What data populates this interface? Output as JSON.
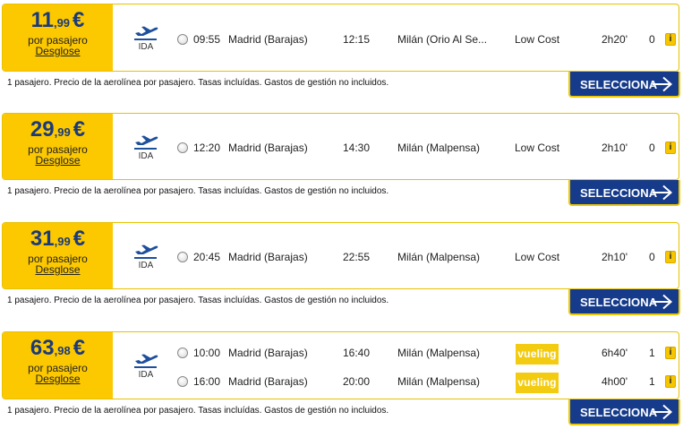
{
  "labels": {
    "per_passenger": "por pasajero",
    "breakdown": "Desglose",
    "direction": "IDA",
    "note": "1 pasajero. Precio de la aerolínea por pasajero. Tasas incluídas. Gastos de gestión no incluidos.",
    "select": "SELECCIONA",
    "info": "i"
  },
  "colors": {
    "price_bg": "#fcc800",
    "price_text": "#1b3a7a",
    "button_bg": "#163b8a",
    "vueling_bg": "#f3cc12"
  },
  "results": [
    {
      "price_int": "11",
      "price_dec": ",99",
      "currency": "€",
      "segments": [
        {
          "dep_time": "09:55",
          "dep_city": "Madrid (Barajas)",
          "arr_time": "12:15",
          "arr_city": "Milán (Orio Al Se...",
          "airline": "Low Cost",
          "airline_logo": "",
          "duration": "2h20'",
          "stops": "0"
        }
      ]
    },
    {
      "price_int": "29",
      "price_dec": ",99",
      "currency": "€",
      "segments": [
        {
          "dep_time": "12:20",
          "dep_city": "Madrid (Barajas)",
          "arr_time": "14:30",
          "arr_city": "Milán (Malpensa)",
          "airline": "Low Cost",
          "airline_logo": "",
          "duration": "2h10'",
          "stops": "0"
        }
      ]
    },
    {
      "price_int": "31",
      "price_dec": ",99",
      "currency": "€",
      "segments": [
        {
          "dep_time": "20:45",
          "dep_city": "Madrid (Barajas)",
          "arr_time": "22:55",
          "arr_city": "Milán (Malpensa)",
          "airline": "Low Cost",
          "airline_logo": "",
          "duration": "2h10'",
          "stops": "0"
        }
      ]
    },
    {
      "price_int": "63",
      "price_dec": ",98",
      "currency": "€",
      "segments": [
        {
          "dep_time": "10:00",
          "dep_city": "Madrid (Barajas)",
          "arr_time": "16:40",
          "arr_city": "Milán (Malpensa)",
          "airline": "",
          "airline_logo": "vueling",
          "duration": "6h40'",
          "stops": "1"
        },
        {
          "dep_time": "16:00",
          "dep_city": "Madrid (Barajas)",
          "arr_time": "20:00",
          "arr_city": "Milán (Malpensa)",
          "airline": "",
          "airline_logo": "vueling",
          "duration": "4h00'",
          "stops": "1"
        }
      ]
    }
  ]
}
